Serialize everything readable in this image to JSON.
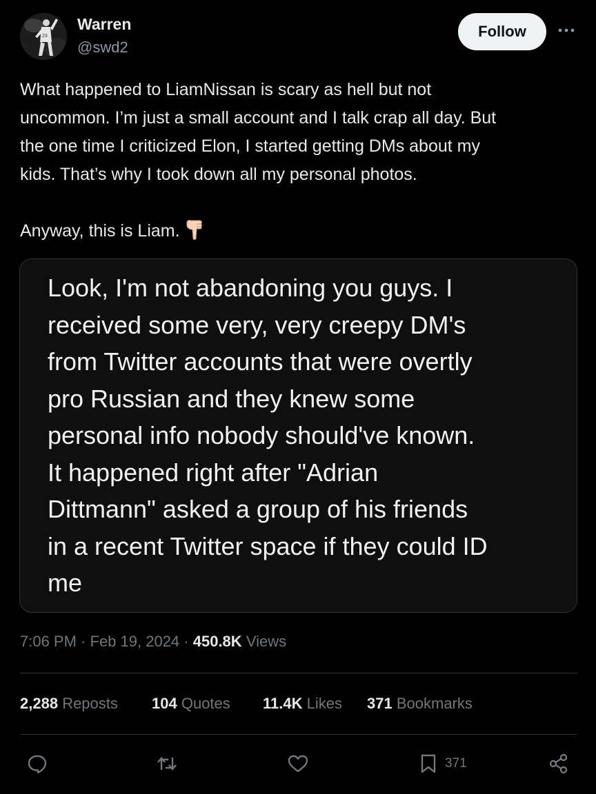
{
  "author": {
    "name": "Warren",
    "handle": "@swd2",
    "avatar_icon": "baseball-player-avatar"
  },
  "follow_label": "Follow",
  "more_icon": "more-horizontal-icon",
  "tweet": {
    "lines": [
      "What happened to LiamNissan is scary as hell but not",
      "uncommon. I’m just a small account and I talk crap all day. But",
      "the one time I criticized Elon, I started getting DMs about my",
      "kids. That’s why I took down all my personal photos."
    ],
    "closing": "Anyway, this is Liam.",
    "closing_emoji": "pointing-down-emoji"
  },
  "media": {
    "lines": [
      "Look, I'm not abandoning you guys. I",
      "received some very, very creepy DM's",
      "from Twitter accounts that were overtly",
      "pro Russian and they knew some",
      "personal info nobody should've known.",
      "It happened right after \"Adrian",
      "Dittmann\" asked a group of his friends",
      "in a recent Twitter space if they could ID",
      "me"
    ]
  },
  "meta": {
    "time": "7:06 PM",
    "date": "Feb 19, 2024",
    "views_count": "450.8K",
    "views_label": "Views"
  },
  "stats": {
    "reposts": {
      "count": "2,288",
      "label": "Reposts"
    },
    "quotes": {
      "count": "104",
      "label": "Quotes"
    },
    "likes": {
      "count": "11.4K",
      "label": "Likes"
    },
    "bookmarks": {
      "count": "371",
      "label": "Bookmarks"
    }
  },
  "actions": {
    "bookmark_count": "371"
  },
  "colors": {
    "background": "#000000",
    "text": "#e7e9ea",
    "secondary": "#71767b",
    "border": "#2f3336",
    "follow_bg": "#eff3f4"
  }
}
